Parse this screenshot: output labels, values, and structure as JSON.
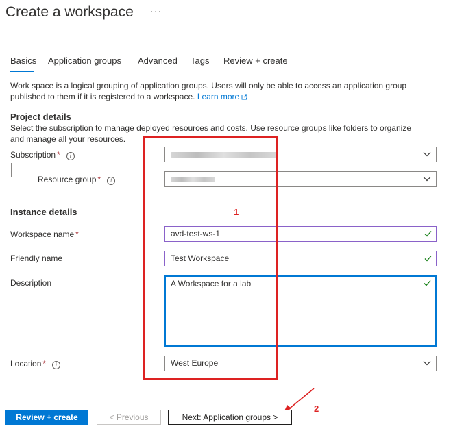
{
  "page": {
    "title": "Create a workspace",
    "more": "···"
  },
  "tabs": [
    {
      "label": "Basics"
    },
    {
      "label": "Application groups"
    },
    {
      "label": "Advanced"
    },
    {
      "label": "Tags"
    },
    {
      "label": "Review + create"
    }
  ],
  "intro": {
    "text": "Work space is a logical grouping of application groups. Users will only be able to access an application group published to them if it is registered to a workspace.",
    "link": "Learn more"
  },
  "project": {
    "heading": "Project details",
    "description": "Select the subscription to manage deployed resources and costs. Use resource groups like folders to organize and manage all your resources.",
    "subscription_label": "Subscription",
    "resource_group_label": "Resource group"
  },
  "instance": {
    "heading": "Instance details",
    "workspace_name_label": "Workspace name",
    "workspace_name_value": "avd-test-ws-1",
    "friendly_name_label": "Friendly name",
    "friendly_name_value": "Test Workspace",
    "description_label": "Description",
    "description_value": "A Workspace for a lab",
    "location_label": "Location",
    "location_value": "West Europe"
  },
  "annotations": {
    "box_number": "1",
    "arrow_number": "2"
  },
  "footer": {
    "review_create": "Review + create",
    "previous": "< Previous",
    "next": "Next: Application groups >"
  },
  "colors": {
    "accent": "#0078d4",
    "annotation": "#dd2222",
    "valid": "#107c10"
  }
}
